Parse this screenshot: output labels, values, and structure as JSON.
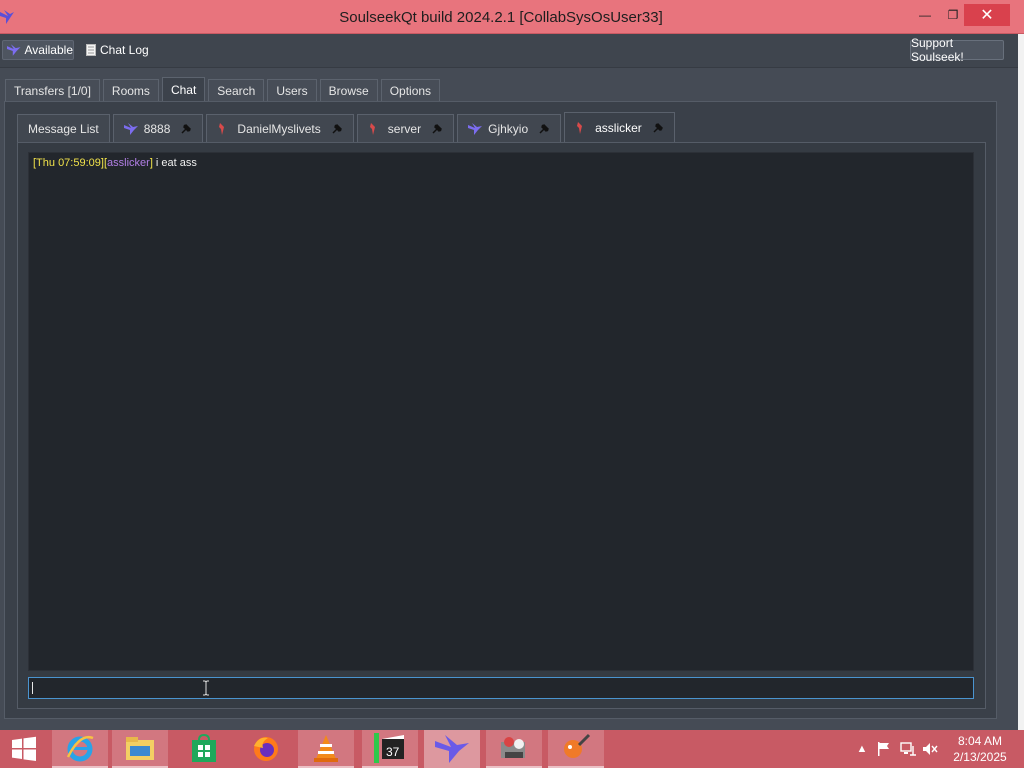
{
  "titlebar": {
    "title": "SoulseekQt build 2024.2.1 [CollabSysOsUser33]",
    "minimize": "—",
    "maximize": "❐",
    "close": "✕"
  },
  "toolbar": {
    "status_label": "Available",
    "chatlog_label": "Chat Log",
    "support_label": "Support Soulseek!"
  },
  "main_tabs": [
    {
      "label": "Transfers [1/0]"
    },
    {
      "label": "Rooms"
    },
    {
      "label": "Chat"
    },
    {
      "label": "Search"
    },
    {
      "label": "Users"
    },
    {
      "label": "Browse"
    },
    {
      "label": "Options"
    }
  ],
  "active_main_tab": "Chat",
  "chat_tabs": [
    {
      "label": "Message List",
      "icon": null
    },
    {
      "label": "8888",
      "icon": "blue-bird-icon"
    },
    {
      "label": "DanielMyslivets",
      "icon": "red-bird-icon"
    },
    {
      "label": "server",
      "icon": "red-bird-icon"
    },
    {
      "label": "Gjhkyio",
      "icon": "blue-bird-icon"
    },
    {
      "label": "asslicker",
      "icon": "red-bird-icon"
    }
  ],
  "active_chat_tab": "asslicker",
  "chat": {
    "messages": [
      {
        "timestamp": "[Thu 07:59:09]",
        "open_bracket": "[",
        "user": "asslicker",
        "close_bracket": "]",
        "text": " i eat ass"
      }
    ],
    "input_value": ""
  },
  "taskbar": {
    "apps": [
      "internet-explorer-icon",
      "file-explorer-icon",
      "store-icon",
      "firefox-icon",
      "vlc-icon",
      "video-editor-icon",
      "soulseek-icon",
      "media-app-icon",
      "paint-app-icon"
    ],
    "clock_time": "8:04 AM",
    "clock_date": "2/13/2025"
  },
  "colors": {
    "titlebar": "#e8747d",
    "taskbar": "#c85a64",
    "timestamp": "#f1e24a",
    "username": "#b27fe6",
    "input_focus": "#4a94d0"
  }
}
